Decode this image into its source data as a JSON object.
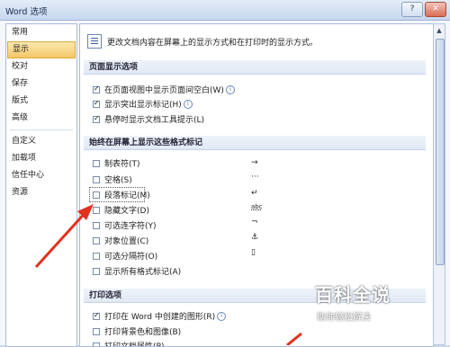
{
  "window": {
    "title": "Word 选项",
    "help_label": "?",
    "close_label": "✕"
  },
  "sidebar": {
    "items": [
      {
        "label": "常用"
      },
      {
        "label": "显示"
      },
      {
        "label": "校对"
      },
      {
        "label": "保存"
      },
      {
        "label": "版式"
      },
      {
        "label": "高级"
      },
      {
        "label": "自定义"
      },
      {
        "label": "加载项"
      },
      {
        "label": "信任中心"
      },
      {
        "label": "资源"
      }
    ],
    "selected": "显示"
  },
  "main": {
    "intro": "更改文档内容在屏幕上的显示方式和在打印时的显示方式。",
    "page_display": {
      "header": "页面显示选项",
      "options": [
        {
          "label": "在页面视图中显示页面间空白(W)",
          "checked": true
        },
        {
          "label": "显示突出显示标记(H)",
          "checked": true
        },
        {
          "label": "悬停时显示文档工具提示(L)",
          "checked": true
        }
      ]
    },
    "format_marks": {
      "header": "始终在屏幕上显示这些格式标记",
      "options": [
        {
          "label": "制表符(T)",
          "checked": false,
          "mark": "→"
        },
        {
          "label": "空格(S)",
          "checked": false,
          "mark": "···"
        },
        {
          "label": "段落标记(M)",
          "checked": false,
          "mark": "↵"
        },
        {
          "label": "隐藏文字(D)",
          "checked": false,
          "mark": "abc"
        },
        {
          "label": "可选连字符(Y)",
          "checked": false,
          "mark": "¬"
        },
        {
          "label": "对象位置(C)",
          "checked": false,
          "mark": "⚓"
        },
        {
          "label": "可选分隔符(O)",
          "checked": false,
          "mark": "▯"
        },
        {
          "label": "显示所有格式标记(A)",
          "checked": false
        }
      ]
    },
    "print": {
      "header": "打印选项",
      "options": [
        {
          "label": "打印在 Word 中创建的图形(R)",
          "checked": true
        },
        {
          "label": "打印背景色和图像(B)",
          "checked": false
        },
        {
          "label": "打印文档属性(P)",
          "checked": false
        }
      ]
    }
  },
  "watermark": {
    "title": "百科全说",
    "subtitle": "助你轻松解决"
  },
  "colors": {
    "annotation_arrow": "#e0321e",
    "selected_bg": "#f6d27d",
    "section_bg": "#e8eef7"
  },
  "icons": {
    "intro": "display-options-icon",
    "info": "info-icon",
    "anchor": "anchor-icon"
  }
}
